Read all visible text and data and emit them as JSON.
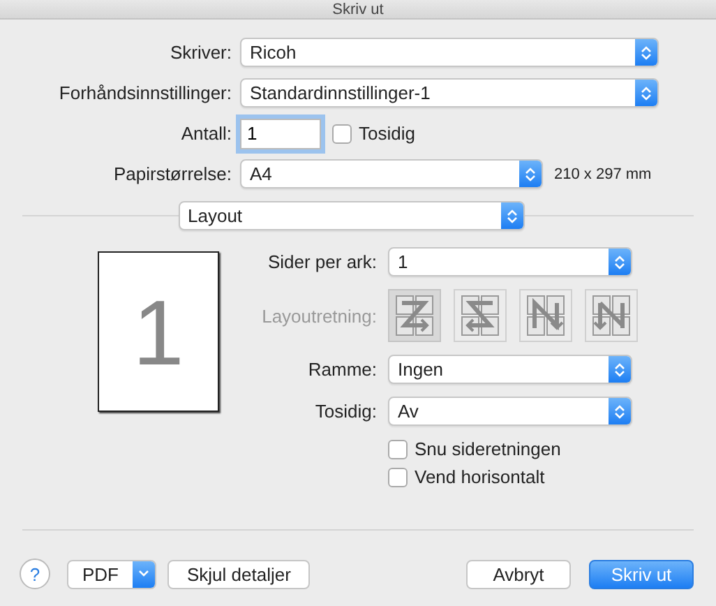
{
  "window": {
    "title": "Skriv ut"
  },
  "printer": {
    "label": "Skriver:",
    "value": "Ricoh"
  },
  "presets": {
    "label": "Forhåndsinnstillinger:",
    "value": "Standardinnstillinger-1"
  },
  "copies": {
    "label": "Antall:",
    "value": "1",
    "duplex": {
      "label": "Tosidig",
      "checked": false
    }
  },
  "paper_size": {
    "label": "Papirstørrelse:",
    "value": "A4",
    "dimensions": "210 x 297 mm"
  },
  "section": {
    "value": "Layout"
  },
  "preview": {
    "page_number": "1"
  },
  "pages_per_sheet": {
    "label": "Sider per ark:",
    "value": "1"
  },
  "layout_direction": {
    "label": "Layoutretning:",
    "disabled": true,
    "options": [
      {
        "kind": "z",
        "selected": true
      },
      {
        "kind": "s",
        "selected": false
      },
      {
        "kind": "n-rev",
        "selected": false
      },
      {
        "kind": "n",
        "selected": false
      }
    ]
  },
  "border": {
    "label": "Ramme:",
    "value": "Ingen"
  },
  "two_sided": {
    "label": "Tosidig:",
    "value": "Av"
  },
  "checkboxes": [
    {
      "label": "Snu sideretningen",
      "checked": false
    },
    {
      "label": "Vend horisontalt",
      "checked": false
    }
  ],
  "footer": {
    "help": "?",
    "pdf": "PDF",
    "details": "Skjul detaljer",
    "cancel": "Avbryt",
    "print": "Skriv ut"
  }
}
